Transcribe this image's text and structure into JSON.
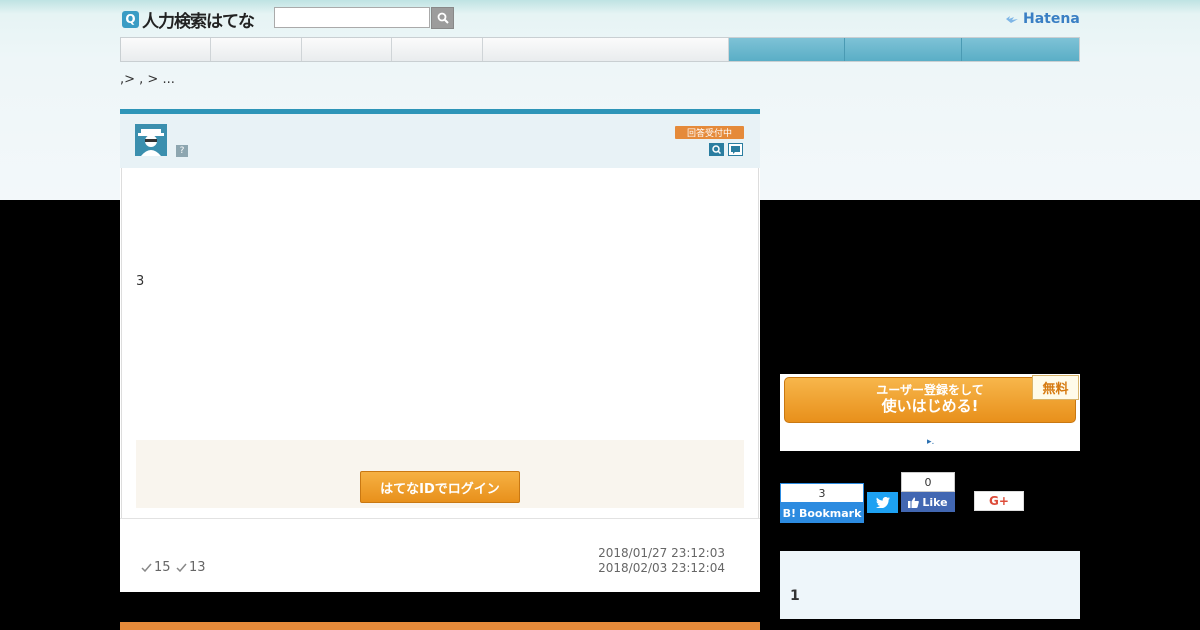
{
  "header": {
    "logo_icon": "Q",
    "logo_text": "人力検索はてな",
    "search_placeholder": "",
    "search_icon": "search-icon",
    "brand": "Hatena"
  },
  "nav": {
    "tabs": [
      "",
      "",
      "",
      "",
      "",
      "",
      "",
      ""
    ]
  },
  "breadcrumb": ",> , >  ...",
  "question": {
    "status": "回答受付中",
    "body": "3",
    "login_label": "はてなIDでログイン",
    "check_count_1": "15",
    "check_count_2": "13",
    "date_posted": "2018/01/27 23:12:03",
    "date_deadline": "2018/02/03 23:12:04"
  },
  "sidebar": {
    "register_line1": "ユーザー登録をして",
    "register_line2": "使いはじめる!",
    "free_label": "無料",
    "register_link": ".",
    "hatena_bookmark_count": "3",
    "hatena_bookmark_label": "Bookmark",
    "facebook_count": "0",
    "facebook_label": "Like",
    "gplus_label": "G+",
    "box_number": "1"
  },
  "colors": {
    "accent_blue": "#2e95b8",
    "orange": "#e58a3a",
    "hatena_bookmark": "#2c8be0",
    "twitter": "#1da1f2",
    "facebook": "#4267b2"
  }
}
